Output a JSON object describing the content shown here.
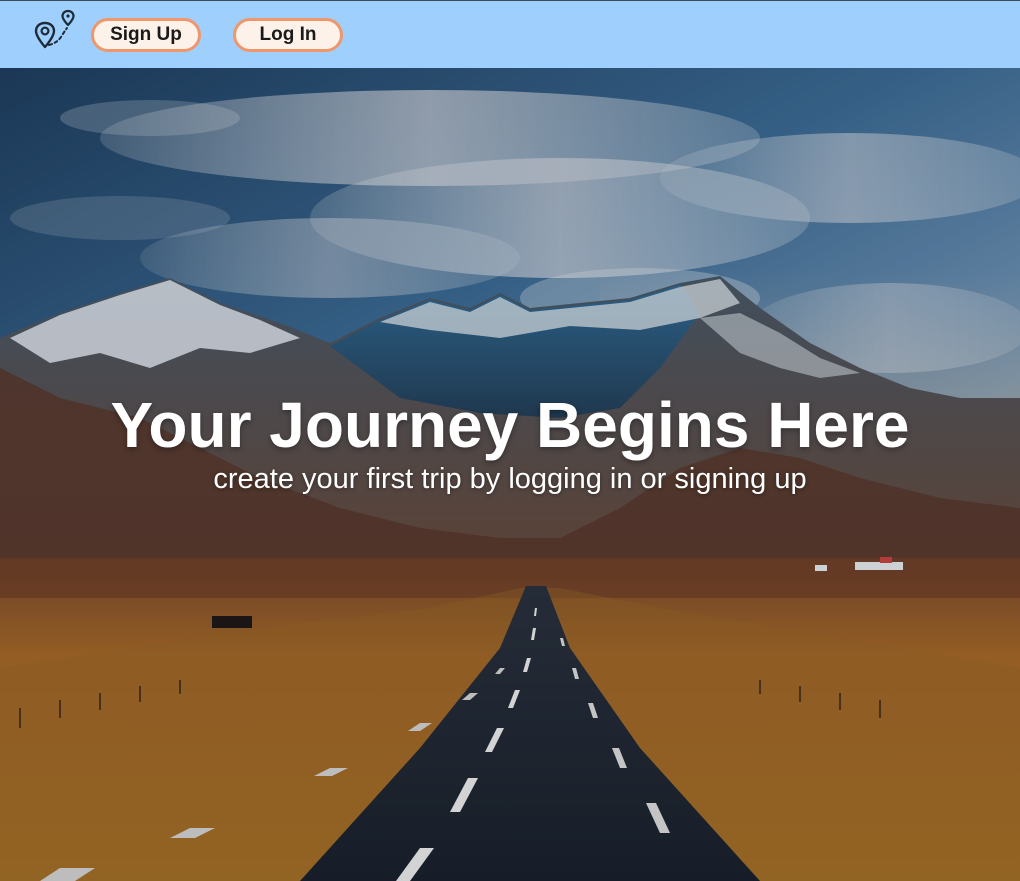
{
  "navbar": {
    "logo_icon": "map-pins-icon",
    "signup_label": "Sign Up",
    "login_label": "Log In",
    "background": "#9fd0fd",
    "button_border": "#f0966b"
  },
  "hero": {
    "title": "Your Journey Begins Here",
    "subtitle": "create your first trip by logging in or signing up",
    "background_image": "mountain-road-landscape"
  }
}
